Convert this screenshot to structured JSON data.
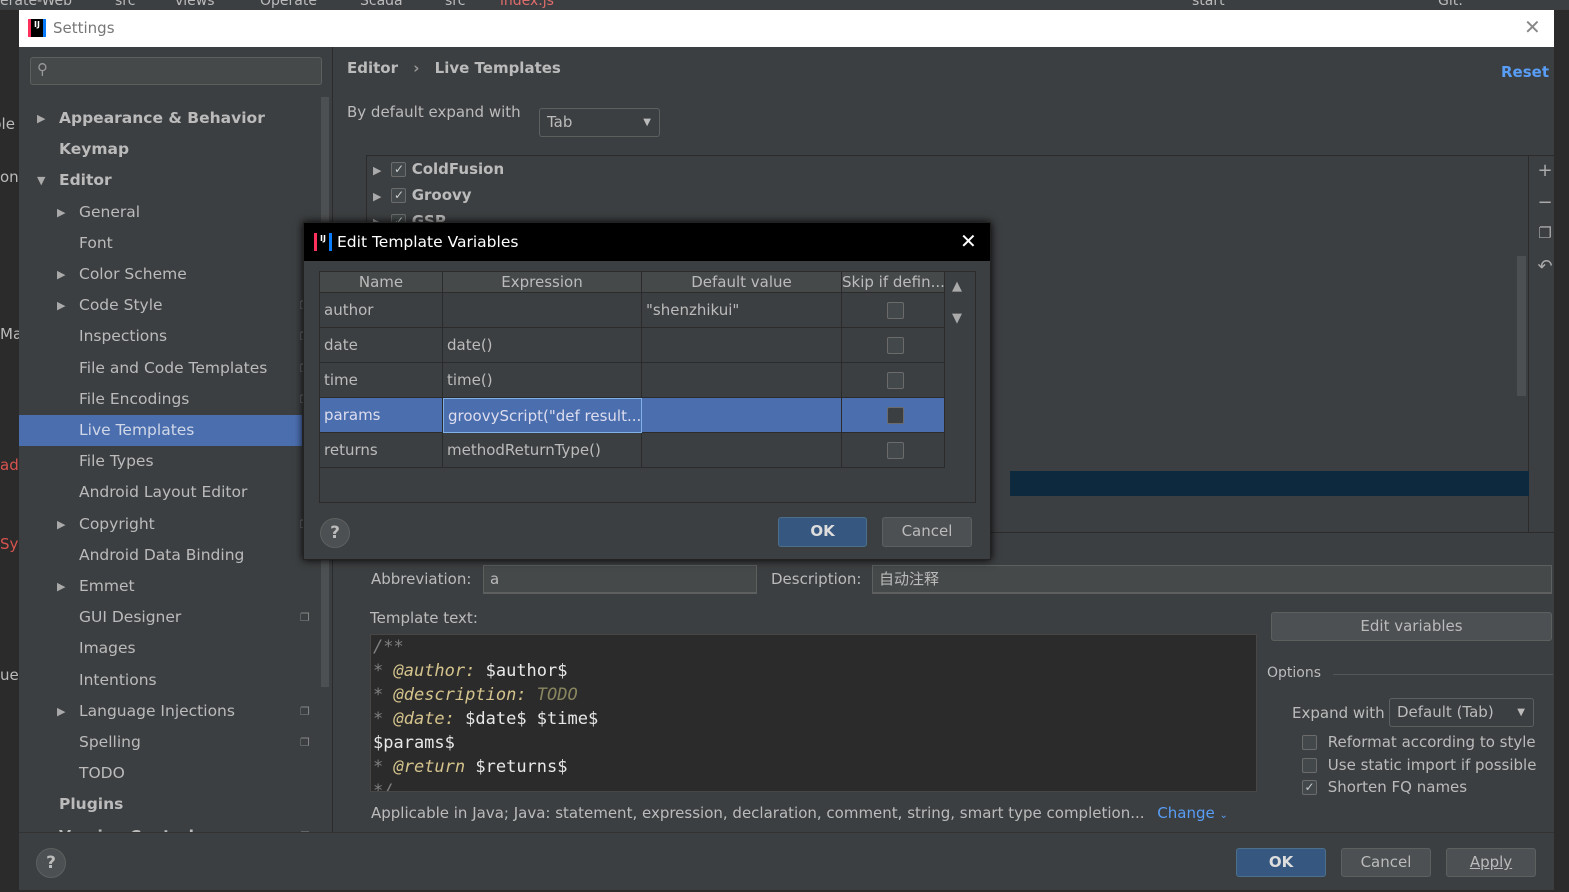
{
  "ide": {
    "breadcrumbs": [
      "erate-Web",
      "src",
      "views",
      "Operate",
      "Scada",
      "src",
      "index.js"
    ],
    "run_config": "start",
    "git_label": "Git:",
    "left_fragments": [
      "ble",
      "on",
      "Ma",
      "ad",
      "Sy",
      "ue"
    ]
  },
  "window": {
    "title": "Settings",
    "close_icon": "close-icon"
  },
  "sidebar": {
    "search_placeholder": "",
    "items": [
      {
        "label": "Appearance & Behavior",
        "level": 0,
        "arrow": "right"
      },
      {
        "label": "Keymap",
        "level": 0
      },
      {
        "label": "Editor",
        "level": 0,
        "arrow": "down"
      },
      {
        "label": "General",
        "level": 1,
        "arrow": "right"
      },
      {
        "label": "Font",
        "level": 1
      },
      {
        "label": "Color Scheme",
        "level": 1,
        "arrow": "right"
      },
      {
        "label": "Code Style",
        "level": 1,
        "arrow": "right",
        "project": true
      },
      {
        "label": "Inspections",
        "level": 1,
        "project": true
      },
      {
        "label": "File and Code Templates",
        "level": 1,
        "project": true
      },
      {
        "label": "File Encodings",
        "level": 1,
        "project": true
      },
      {
        "label": "Live Templates",
        "level": 1,
        "selected": true
      },
      {
        "label": "File Types",
        "level": 1
      },
      {
        "label": "Android Layout Editor",
        "level": 1
      },
      {
        "label": "Copyright",
        "level": 1,
        "arrow": "right",
        "project": true
      },
      {
        "label": "Android Data Binding",
        "level": 1
      },
      {
        "label": "Emmet",
        "level": 1,
        "arrow": "right"
      },
      {
        "label": "GUI Designer",
        "level": 1,
        "project": true
      },
      {
        "label": "Images",
        "level": 1
      },
      {
        "label": "Intentions",
        "level": 1
      },
      {
        "label": "Language Injections",
        "level": 1,
        "arrow": "right",
        "project": true
      },
      {
        "label": "Spelling",
        "level": 1,
        "project": true
      },
      {
        "label": "TODO",
        "level": 1
      },
      {
        "label": "Plugins",
        "level": 0
      },
      {
        "label": "Version Control",
        "level": 0,
        "arrow": "right",
        "project": true
      }
    ]
  },
  "main": {
    "breadcrumb": [
      "Editor",
      "Live Templates"
    ],
    "reset": "Reset",
    "expand_label": "By default expand with",
    "expand_value": "Tab",
    "groups": [
      {
        "label": "ColdFusion",
        "checked": true
      },
      {
        "label": "Groovy",
        "checked": true
      },
      {
        "label": "GSP",
        "checked": true
      }
    ],
    "abbreviation_label": "Abbreviation:",
    "abbreviation_value": "a",
    "description_label": "Description:",
    "description_value": "自动注释",
    "template_text_label": "Template text:",
    "template_lines": [
      "/**",
      " * @author: $author$",
      " * @description: TODO",
      " * @date: $date$ $time$",
      "$params$",
      " * @return $returns$",
      " */"
    ],
    "edit_variables": "Edit variables",
    "options_label": "Options",
    "options_expand_label": "Expand with",
    "options_expand_value": "Default (Tab)",
    "options": [
      {
        "label": "Reformat according to style",
        "checked": false
      },
      {
        "label": "Use static import if possible",
        "checked": false
      },
      {
        "label": "Shorten FQ names",
        "checked": true
      }
    ],
    "applicable": "Applicable in Java; Java: statement, expression, declaration, comment, string, smart type completion...",
    "change": "Change"
  },
  "footer": {
    "ok": "OK",
    "cancel": "Cancel",
    "apply": "Apply",
    "help": "?"
  },
  "dialog": {
    "title": "Edit Template Variables",
    "columns": [
      "Name",
      "Expression",
      "Default value",
      "Skip if defin..."
    ],
    "rows": [
      {
        "name": "author",
        "expression": "",
        "default": "\"shenzhikui\"",
        "skip": false
      },
      {
        "name": "date",
        "expression": "date()",
        "default": "",
        "skip": false
      },
      {
        "name": "time",
        "expression": "time()",
        "default": "",
        "skip": false
      },
      {
        "name": "params",
        "expression": "groovyScript(\"def result...",
        "default": "",
        "skip": false,
        "selected": true
      },
      {
        "name": "returns",
        "expression": "methodReturnType()",
        "default": "",
        "skip": false
      }
    ],
    "ok": "OK",
    "cancel": "Cancel",
    "help": "?"
  },
  "colors": {
    "accent": "#4b6eaf",
    "link": "#589df6",
    "default_button": "#365880"
  }
}
